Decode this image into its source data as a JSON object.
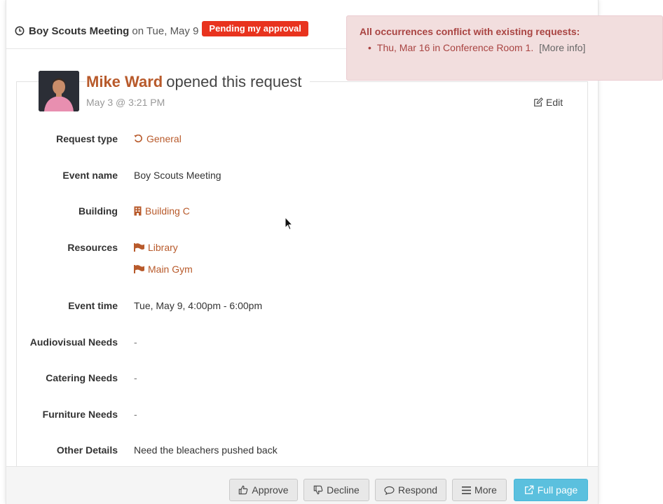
{
  "header": {
    "event_name": "Boy Scouts Meeting",
    "on_date": "on Tue, May 9",
    "status_badge": "Pending my approval"
  },
  "request": {
    "user_name": "Mike Ward",
    "opened_text": "opened this request",
    "opened_date": "May 3 @ 3:21 PM",
    "edit_label": "Edit"
  },
  "fields": {
    "request_type": {
      "label": "Request type",
      "value": "General"
    },
    "event_name": {
      "label": "Event name",
      "value": "Boy Scouts Meeting"
    },
    "building": {
      "label": "Building",
      "value": "Building C"
    },
    "resources": {
      "label": "Resources",
      "values": [
        "Library",
        "Main Gym"
      ]
    },
    "event_time": {
      "label": "Event time",
      "value": "Tue, May 9, 4:00pm - 6:00pm"
    },
    "audiovisual": {
      "label": "Audiovisual Needs",
      "value": "-"
    },
    "catering": {
      "label": "Catering Needs",
      "value": "-"
    },
    "furniture": {
      "label": "Furniture Needs",
      "value": "-"
    },
    "other": {
      "label": "Other Details",
      "value": "Need the bleachers pushed back"
    }
  },
  "footer": {
    "approve": "Approve",
    "decline": "Decline",
    "respond": "Respond",
    "more": "More",
    "full_page": "Full page"
  },
  "alert": {
    "title": "All occurrences conflict with existing requests:",
    "items": [
      {
        "text": "Thu, Mar 16 in Conference Room 1.",
        "more": "[More info]"
      }
    ]
  },
  "colors": {
    "link": "#b85a2b",
    "badge": "#e8331e",
    "alert_bg": "#f2dede",
    "alert_text": "#a94442",
    "primary_button": "#5bc0de"
  },
  "icons": {
    "header": "clock-icon",
    "edit": "edit-icon",
    "request_type": "refresh-icon",
    "building": "building-icon",
    "resources": "flag-icon",
    "approve": "thumbs-up-icon",
    "decline": "thumbs-down-icon",
    "respond": "comment-icon",
    "more": "bars-icon",
    "full_page": "external-link-icon"
  }
}
